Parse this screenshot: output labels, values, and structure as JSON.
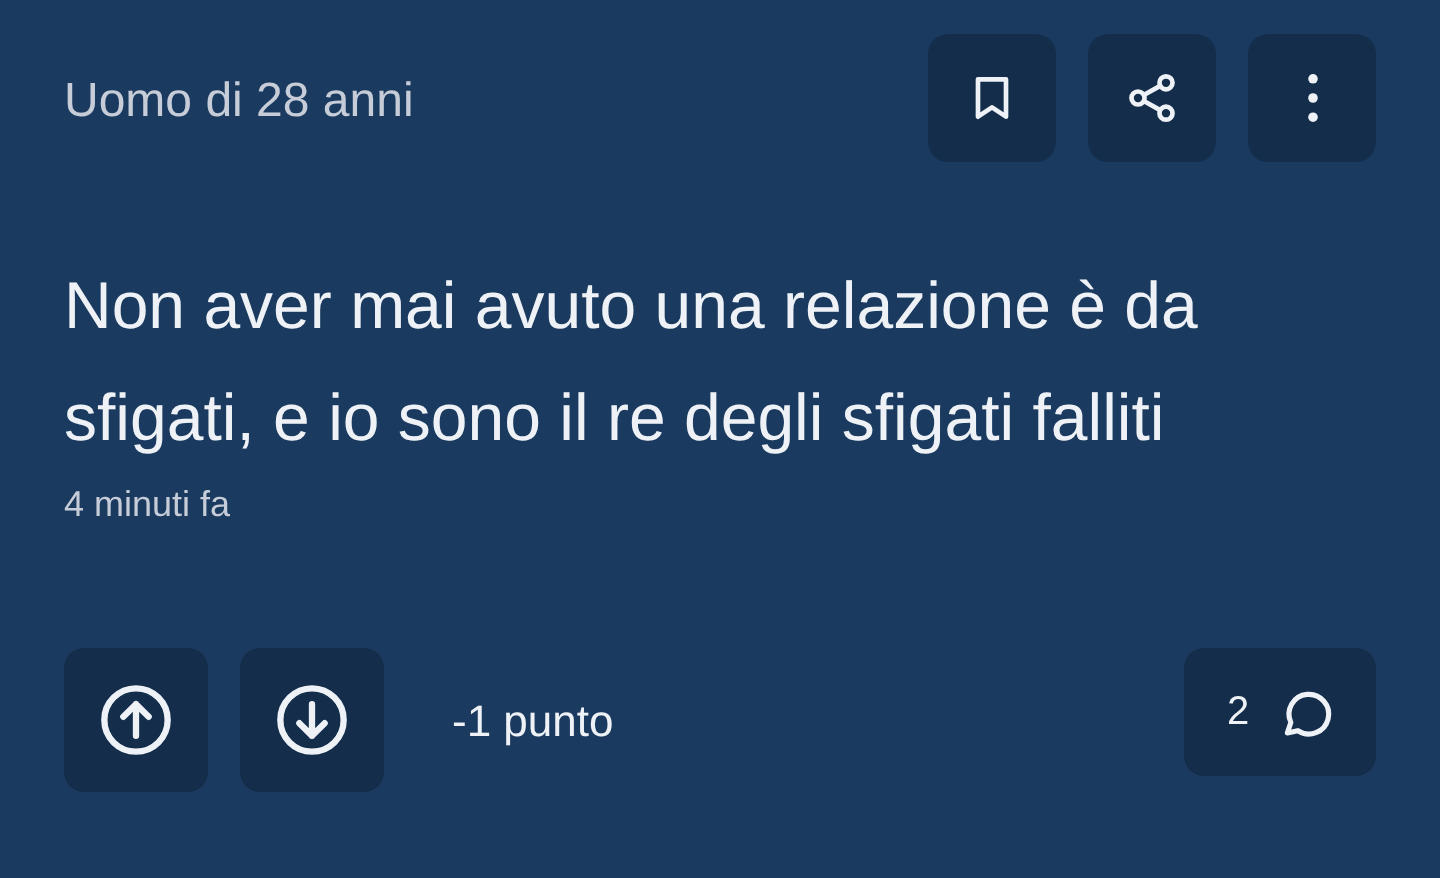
{
  "author": "Uomo di 28 anni",
  "actions": [
    {
      "kind": "bookmark"
    },
    {
      "kind": "share"
    },
    {
      "kind": "more"
    }
  ],
  "text": "Non aver mai avuto una relazione è da sfigati, e io sono il re degli sfigati falliti",
  "time": "4 minuti fa",
  "score": "-1 punto",
  "comments": "2"
}
